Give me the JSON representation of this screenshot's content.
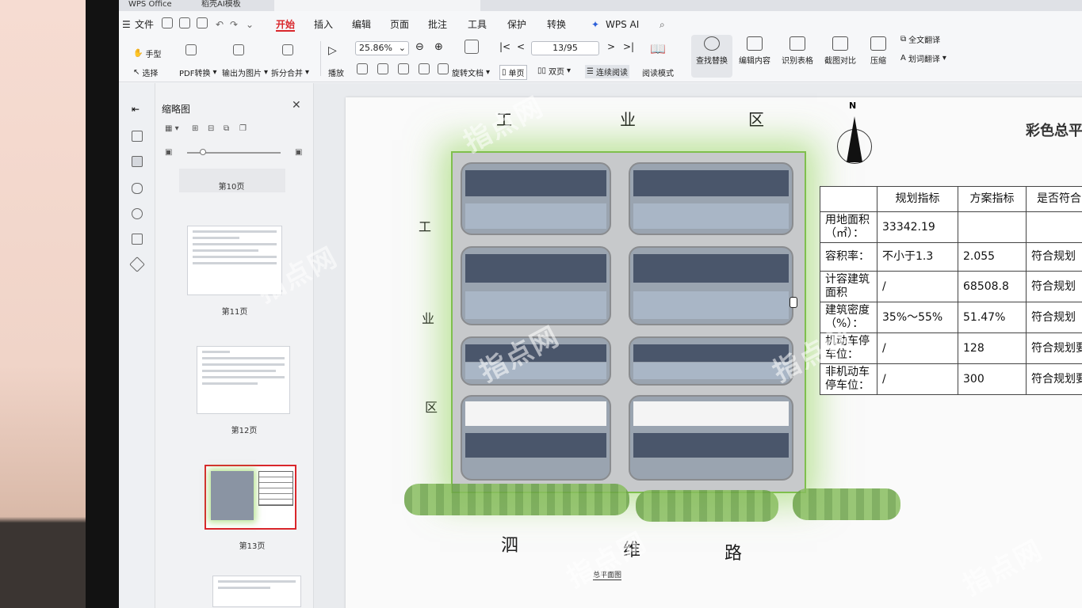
{
  "tabs": [
    "WPS Office",
    "稻壳AI模板",
    ""
  ],
  "menu": {
    "file": "文件",
    "items": [
      "开始",
      "插入",
      "编辑",
      "页面",
      "批注",
      "工具",
      "保护",
      "转换"
    ],
    "ai": "WPS AI"
  },
  "ribbon": {
    "hand": "手型",
    "select": "选择",
    "pdf_convert": "PDF转换",
    "export_image": "输出为图片",
    "split_merge": "拆分合并",
    "play": "播放",
    "zoom": "25.86%",
    "page": "13/95",
    "rotate": "旋转文档",
    "single": "单页",
    "double": "双页",
    "continuous": "连续阅读",
    "read_mode": "阅读模式",
    "find_replace": "查找替换",
    "edit_content": "编辑内容",
    "recognize_table": "识别表格",
    "compare": "截图对比",
    "compress": "压缩",
    "translate_full": "全文翻译",
    "translate_word": "划词翻译"
  },
  "thumbnails": {
    "title": "缩略图",
    "pages": [
      "第10页",
      "第11页",
      "第12页",
      "第13页"
    ]
  },
  "document": {
    "top_label": [
      "工",
      "业",
      "区"
    ],
    "left_label": [
      "工",
      "业",
      "区"
    ],
    "road": [
      "泗",
      "维",
      "路"
    ],
    "north": "N",
    "title": "彩色总平",
    "caption": "总平面图",
    "table": {
      "headers": [
        "",
        "规划指标",
        "方案指标",
        "是否符合"
      ],
      "rows": [
        [
          "用地面积（㎡）：",
          "33342.19",
          "",
          ""
        ],
        [
          "容积率：",
          "不小于1.3",
          "2.055",
          "符合规划"
        ],
        [
          "计容建筑面积",
          "/",
          "68508.8",
          "符合规划"
        ],
        [
          "建筑密度（%）：",
          "35%～55%",
          "51.47%",
          "符合规划"
        ],
        [
          "机动车停车位：",
          "/",
          "128",
          "符合规划要"
        ],
        [
          "非机动车停车位：",
          "/",
          "300",
          "符合规划要"
        ]
      ]
    }
  },
  "watermark": "指点网",
  "colors": {
    "accent": "#d9262b",
    "site_green": "#7fbf4d",
    "building_dark": "#4a566b"
  }
}
